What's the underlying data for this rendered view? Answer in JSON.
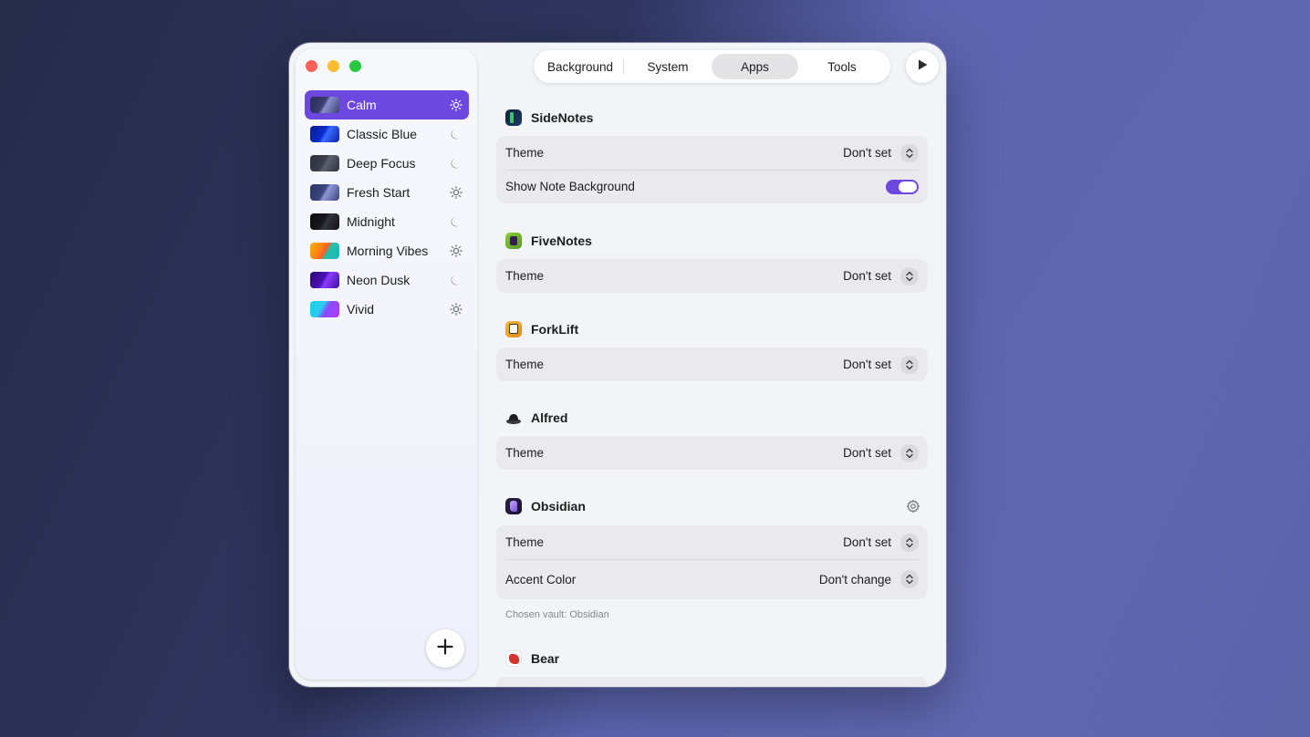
{
  "sidebar": {
    "themes": [
      {
        "name": "Calm",
        "mode": "light",
        "selected": true
      },
      {
        "name": "Classic Blue",
        "mode": "dark"
      },
      {
        "name": "Deep Focus",
        "mode": "dark"
      },
      {
        "name": "Fresh Start",
        "mode": "light"
      },
      {
        "name": "Midnight",
        "mode": "dark"
      },
      {
        "name": "Morning Vibes",
        "mode": "light"
      },
      {
        "name": "Neon Dusk",
        "mode": "dark"
      },
      {
        "name": "Vivid",
        "mode": "light"
      }
    ],
    "add_button_icon": "plus-icon"
  },
  "tabs": [
    {
      "label": "Background",
      "active": false
    },
    {
      "label": "System",
      "active": false
    },
    {
      "label": "Apps",
      "active": true
    },
    {
      "label": "Tools",
      "active": false
    }
  ],
  "apps": {
    "sidenotes": {
      "name": "SideNotes",
      "theme_label": "Theme",
      "theme_value": "Don't set",
      "bg_label": "Show Note Background",
      "bg_enabled": true
    },
    "fivenotes": {
      "name": "FiveNotes",
      "theme_label": "Theme",
      "theme_value": "Don't set"
    },
    "forklift": {
      "name": "ForkLift",
      "theme_label": "Theme",
      "theme_value": "Don't set"
    },
    "alfred": {
      "name": "Alfred",
      "theme_label": "Theme",
      "theme_value": "Don't set"
    },
    "obsidian": {
      "name": "Obsidian",
      "theme_label": "Theme",
      "theme_value": "Don't set",
      "accent_label": "Accent Color",
      "accent_value": "Don't change",
      "vault_note": "Chosen vault: Obsidian"
    },
    "bear": {
      "name": "Bear"
    }
  },
  "colors": {
    "accent": "#6c47e0",
    "window_bg": "#f3f4f8",
    "card_bg": "#e9e9ee"
  }
}
